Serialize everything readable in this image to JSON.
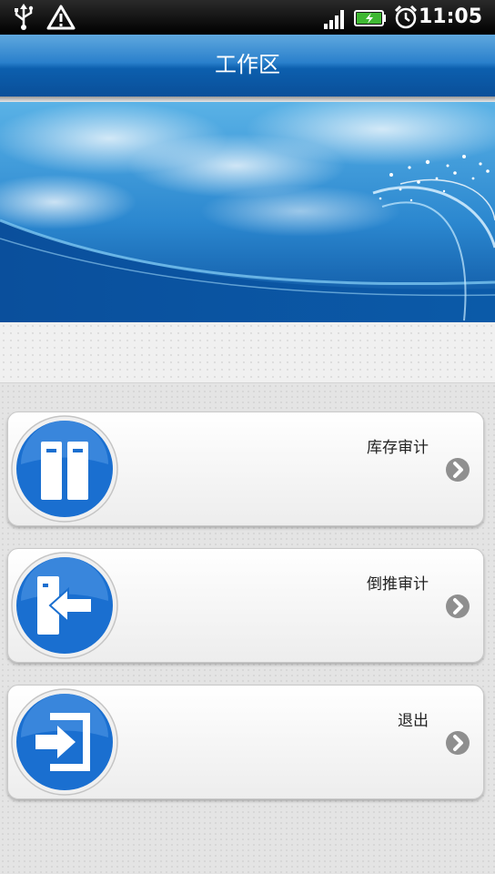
{
  "status_bar": {
    "time": "11:05",
    "icons": [
      "usb-icon",
      "warning-icon",
      "signal-icon",
      "battery-charging-icon",
      "alarm-icon"
    ]
  },
  "header": {
    "title": "工作区"
  },
  "menu": [
    {
      "label": "库存审计",
      "icon": "inventory-audit-icon"
    },
    {
      "label": "倒推审计",
      "icon": "backtrack-audit-icon"
    },
    {
      "label": "退出",
      "icon": "exit-icon"
    }
  ],
  "colors": {
    "header_blue": "#0c5fae",
    "icon_blue": "#1a6fd0",
    "chevron_gray": "#8f8f8f"
  }
}
